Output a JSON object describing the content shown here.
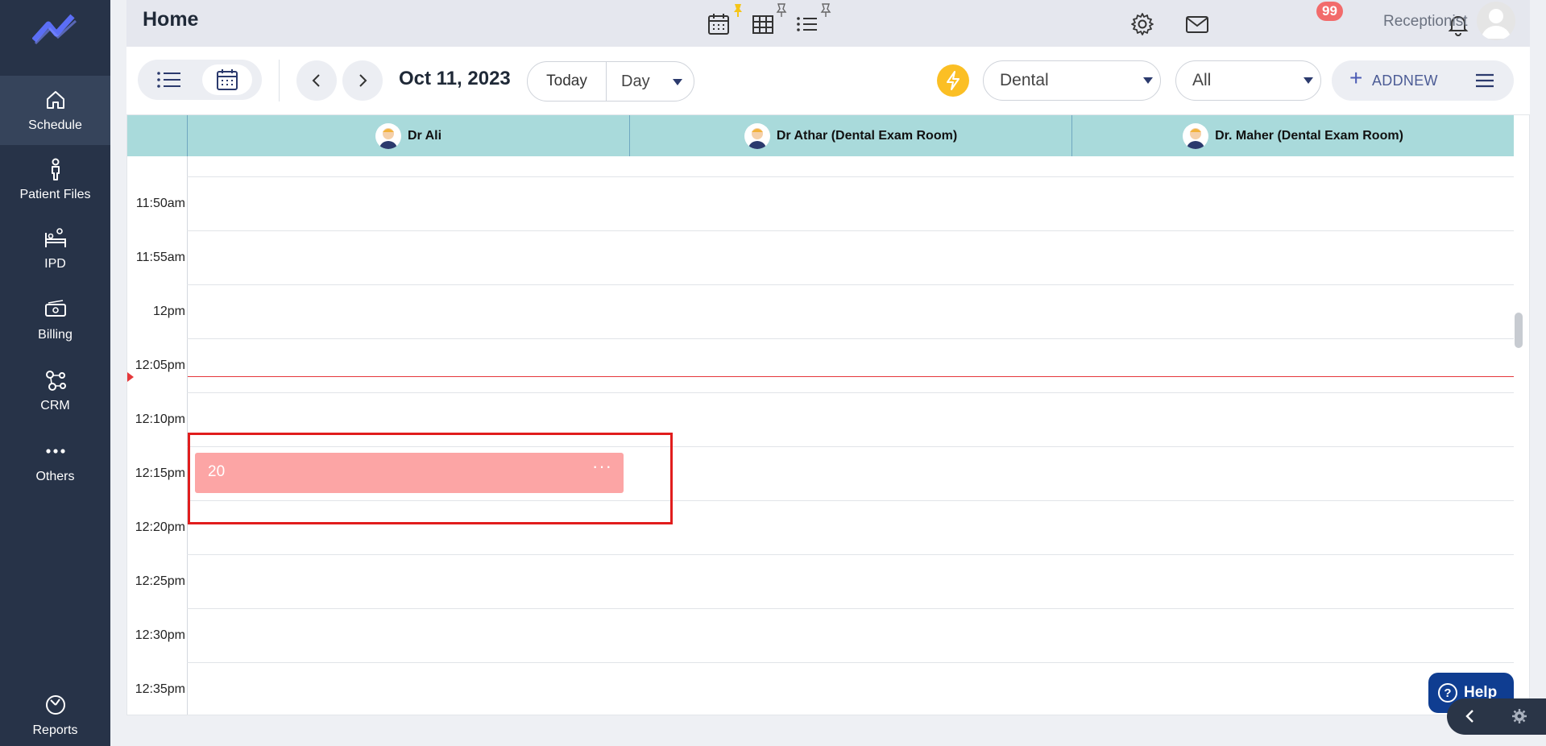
{
  "sidebar": {
    "items": [
      {
        "label": "Schedule",
        "icon": "home-icon"
      },
      {
        "label": "Patient Files",
        "icon": "person-icon"
      },
      {
        "label": "IPD",
        "icon": "bed-icon"
      },
      {
        "label": "Billing",
        "icon": "cash-icon"
      },
      {
        "label": "CRM",
        "icon": "network-icon"
      },
      {
        "label": "Others",
        "icon": "dots-icon"
      }
    ],
    "reports": {
      "label": "Reports",
      "icon": "pie-chart-icon"
    }
  },
  "header": {
    "title": "Home",
    "notification_count": "99",
    "user_role": "Receptionist"
  },
  "toolbar": {
    "date": "Oct 11, 2023",
    "today_label": "Today",
    "view_label": "Day",
    "specialty_select": "Dental",
    "filter_select": "All",
    "addnew_label": "ADDNEW"
  },
  "calendar": {
    "resources": [
      "Dr Ali",
      "Dr Athar (Dental Exam Room)",
      "Dr. Maher (Dental Exam Room)"
    ],
    "time_slots": [
      "11:50am",
      "11:55am",
      "12pm",
      "12:05pm",
      "12:10pm",
      "12:15pm",
      "12:20pm",
      "12:25pm",
      "12:30pm",
      "12:35pm"
    ],
    "event": {
      "title": "20",
      "more": "···"
    }
  },
  "help": {
    "label": "Help"
  },
  "colors": {
    "sidebar": "#273348",
    "accent": "#2b3a6d",
    "event": "#fca5a5",
    "now_line": "#e5383b",
    "header_row": "#a9dadb",
    "help": "#0f3d91"
  }
}
